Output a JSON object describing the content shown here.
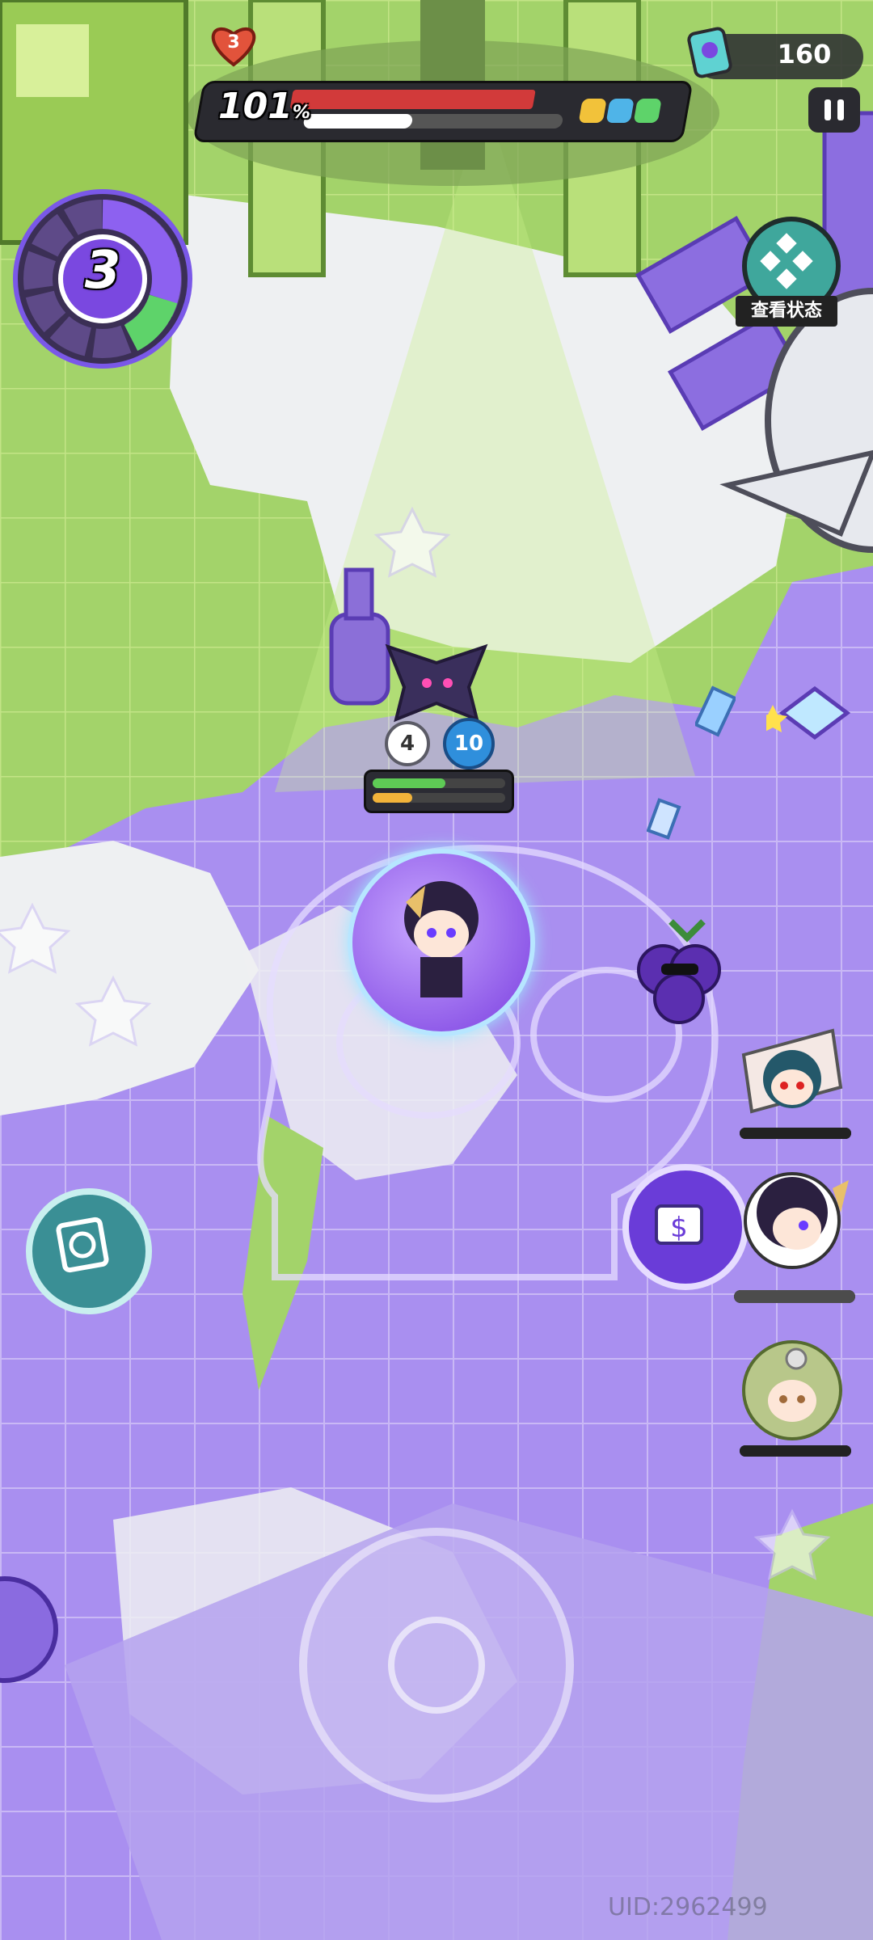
{
  "hud": {
    "lives_count": "3",
    "progress_percent_label": "101",
    "progress_percent_suffix": "%",
    "boss_hp_fraction": 1.0,
    "charge_fraction": 0.42,
    "currency_value": "160",
    "pause_icon": "pause-icon",
    "currency_icon": "ticket-icon"
  },
  "wave_dial": {
    "wave_number": "3"
  },
  "status_button": {
    "label": "查看状态",
    "icon": "diamond-grid-icon"
  },
  "enemy": {
    "counter_left": "4",
    "counter_right": "10",
    "hp_fraction": 0.55,
    "cast_fraction": 0.3
  },
  "party": [
    {
      "name": "teammate-1",
      "hp_fraction": 1.0
    },
    {
      "name": "teammate-2",
      "hp_fraction": 1.0
    },
    {
      "name": "teammate-3",
      "hp_fraction": 1.0
    }
  ],
  "footer": {
    "uid": "UID:2962499"
  },
  "colors": {
    "purple_floor": "#9a7ee6",
    "green_terrain": "#a3d36a",
    "white_cloud": "#eef0f2",
    "accent_teal": "#3fa79c",
    "hp_red": "#d23a3a"
  }
}
